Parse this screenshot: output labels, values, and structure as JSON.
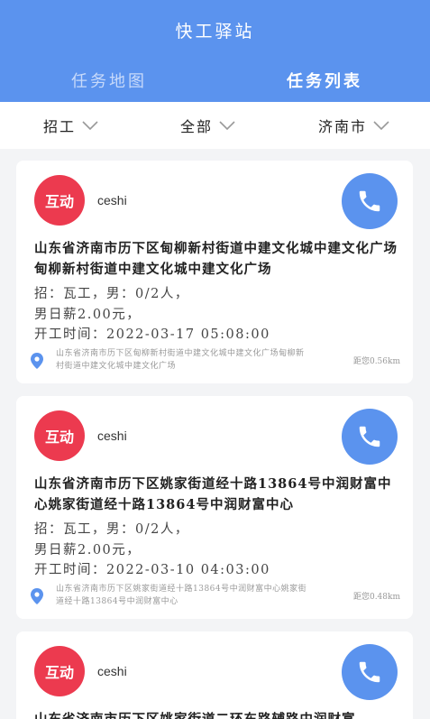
{
  "header": {
    "title": "快工驿站",
    "tabs": [
      {
        "label": "任务地图"
      },
      {
        "label": "任务列表"
      }
    ]
  },
  "filters": [
    {
      "label": "招工"
    },
    {
      "label": "全部"
    },
    {
      "label": "济南市"
    }
  ],
  "colors": {
    "primary": "#5b93ee",
    "badge": "#ec3a4f",
    "background": "#f3f4f6"
  },
  "tasks": [
    {
      "badge": "互动",
      "user": "ceshi",
      "address": "山东省济南市历下区甸柳新村街道中建文化城中建文化广场甸柳新村街道中建文化城中建文化广场",
      "recruit": "招：瓦工，男：0/2人，",
      "wage": "男日薪2.00元，",
      "start_time": "开工时间：2022-03-17 05:08:00",
      "location": "山东省济南市历下区甸柳新村街道中建文化城中建文化广场甸柳新村街道中建文化城中建文化广场",
      "distance": "距您0.56km"
    },
    {
      "badge": "互动",
      "user": "ceshi",
      "address": "山东省济南市历下区姚家街道经十路13864号中润财富中心姚家街道经十路13864号中润财富中心",
      "recruit": "招：瓦工，男：0/2人，",
      "wage": "男日薪2.00元，",
      "start_time": "开工时间：2022-03-10 04:03:00",
      "location": "山东省济南市历下区姚家街道经十路13864号中润财富中心姚家街道经十路13864号中润财富中心",
      "distance": "距您0.48km"
    },
    {
      "badge": "互动",
      "user": "ceshi",
      "address": "山东省济南市历下区姚家街道二环东路辅路中润财富"
    }
  ]
}
